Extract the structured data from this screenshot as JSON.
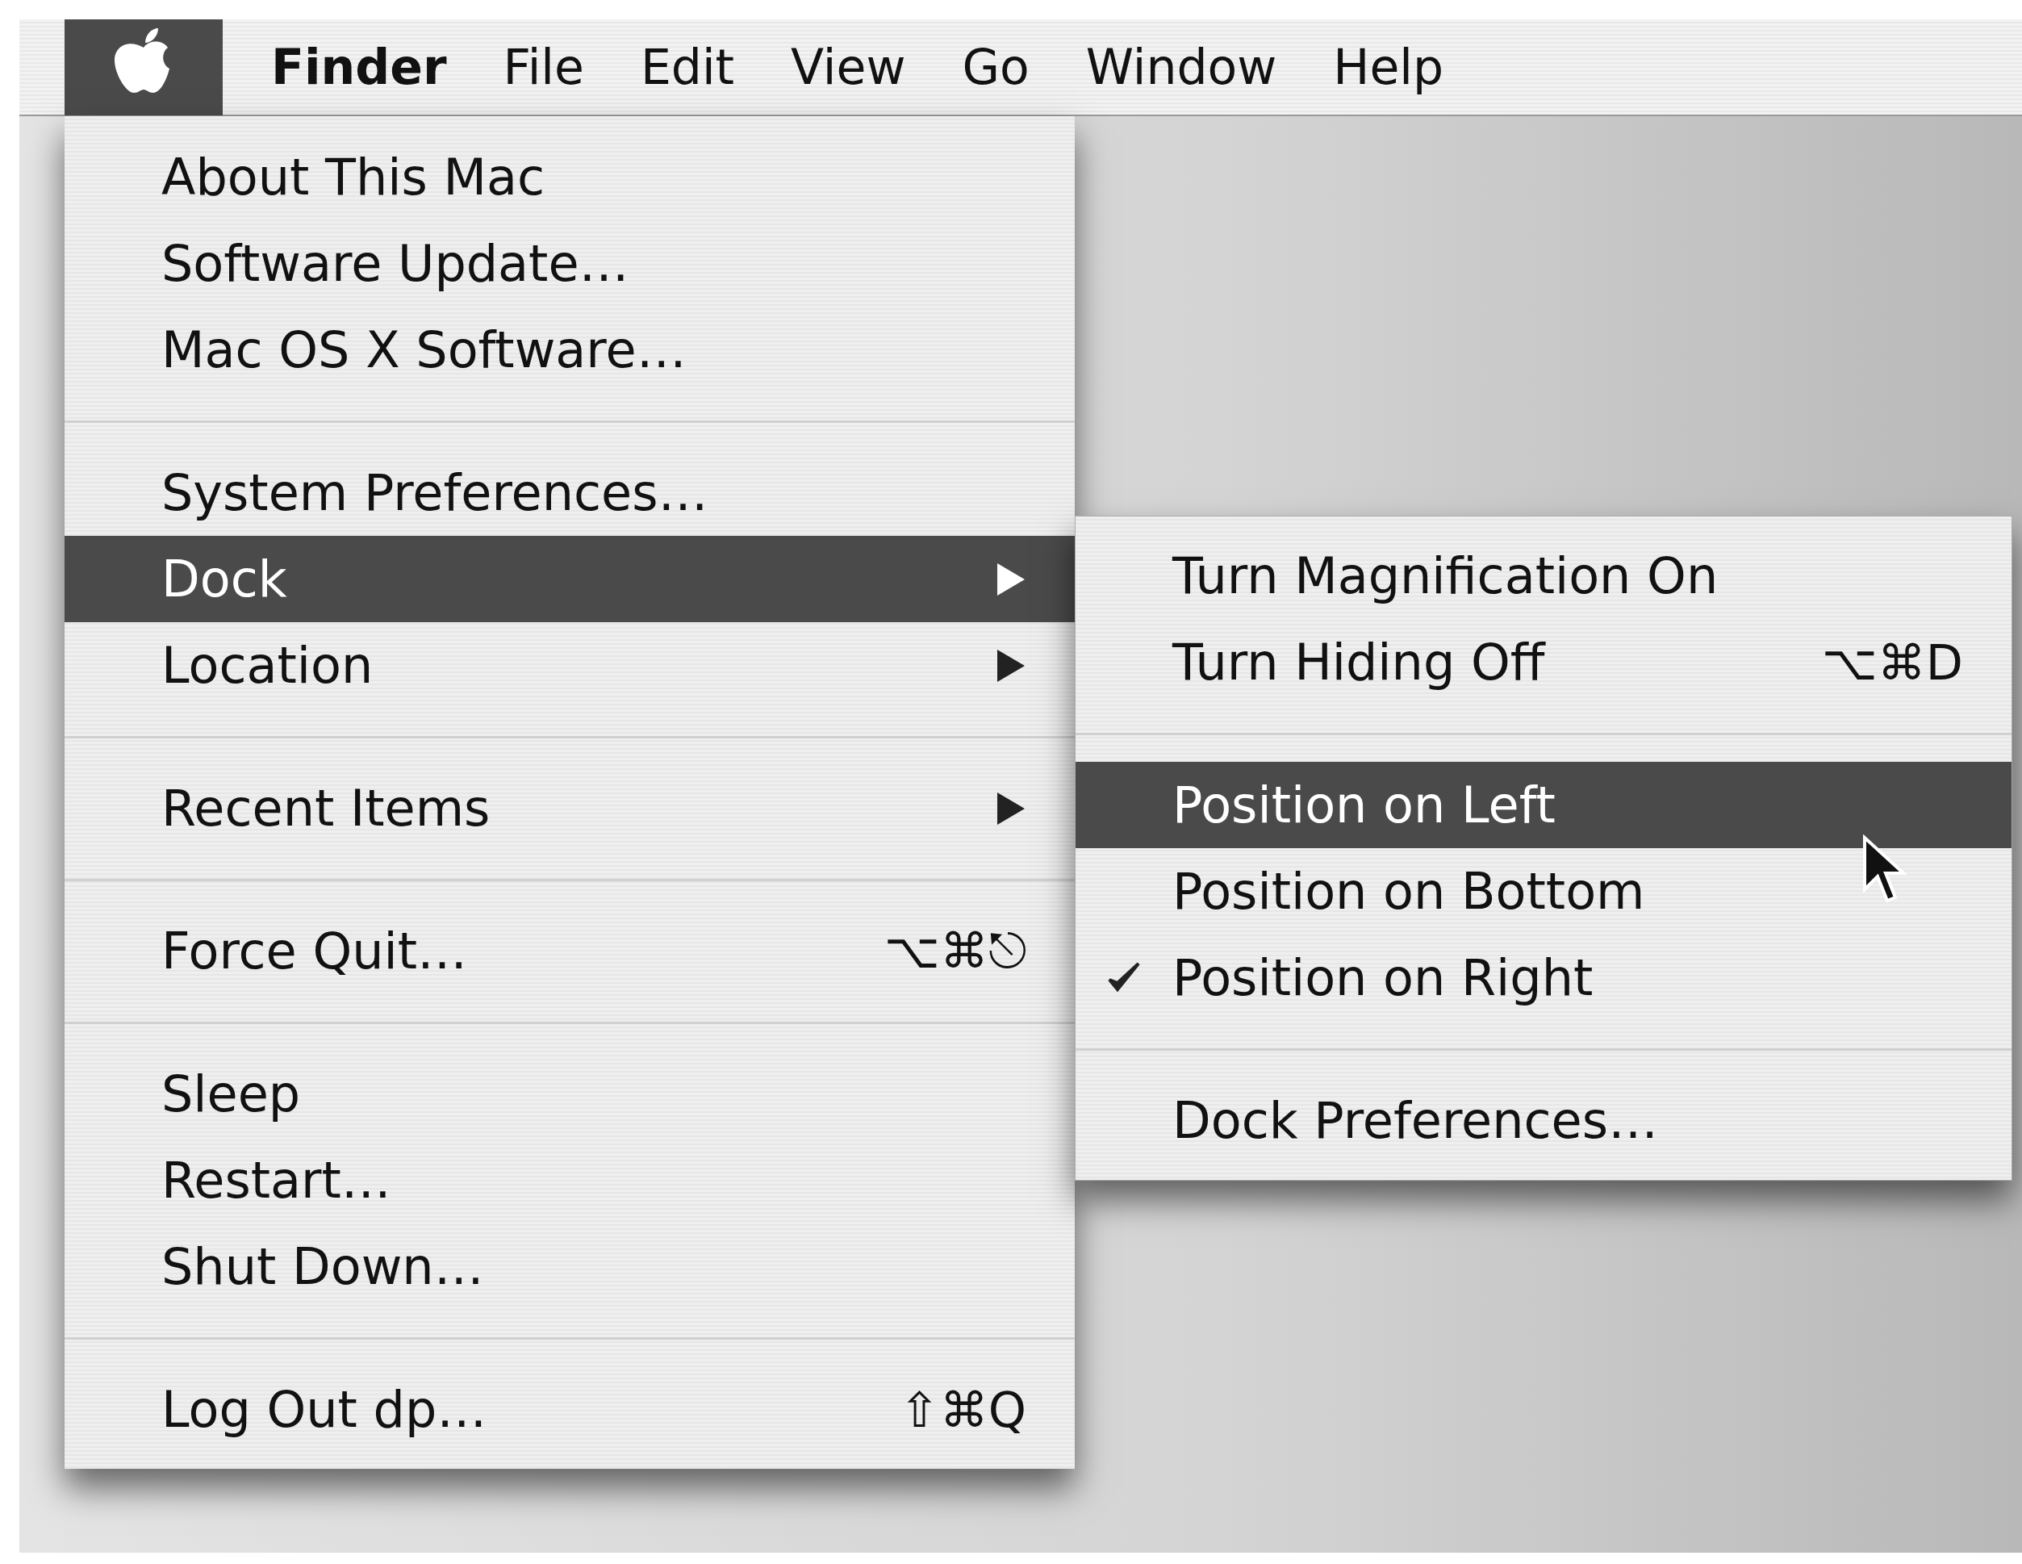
{
  "menu_bar": {
    "apple_selected": true,
    "items": [
      {
        "label": "Finder",
        "kind": "app"
      },
      {
        "label": "File",
        "kind": "menu"
      },
      {
        "label": "Edit",
        "kind": "menu"
      },
      {
        "label": "View",
        "kind": "menu"
      },
      {
        "label": "Go",
        "kind": "menu"
      },
      {
        "label": "Window",
        "kind": "menu"
      },
      {
        "label": "Help",
        "kind": "menu"
      }
    ]
  },
  "apple_menu": {
    "items": [
      {
        "kind": "item",
        "label": "About This Mac",
        "selected": false
      },
      {
        "kind": "item",
        "label": "Software Update…",
        "selected": false
      },
      {
        "kind": "item",
        "label": "Mac OS X Software…",
        "selected": false
      },
      {
        "kind": "separator"
      },
      {
        "kind": "item",
        "label": "System Preferences…",
        "selected": false
      },
      {
        "kind": "submenu",
        "label": "Dock",
        "selected": true
      },
      {
        "kind": "submenu",
        "label": "Location",
        "selected": false
      },
      {
        "kind": "separator"
      },
      {
        "kind": "submenu",
        "label": "Recent Items",
        "selected": false
      },
      {
        "kind": "separator"
      },
      {
        "kind": "item",
        "label": "Force Quit…",
        "shortcut": "⌥⌘⎋",
        "selected": false
      },
      {
        "kind": "separator"
      },
      {
        "kind": "item",
        "label": "Sleep",
        "selected": false
      },
      {
        "kind": "item",
        "label": "Restart…",
        "selected": false
      },
      {
        "kind": "item",
        "label": "Shut Down…",
        "selected": false
      },
      {
        "kind": "separator"
      },
      {
        "kind": "item",
        "label": "Log Out dp…",
        "shortcut": "⇧⌘Q",
        "selected": false
      }
    ]
  },
  "dock_submenu": {
    "items": [
      {
        "kind": "item",
        "label": "Turn Magnification On",
        "checked": false,
        "selected": false
      },
      {
        "kind": "item",
        "label": "Turn Hiding Off",
        "shortcut": "⌥⌘D",
        "checked": false,
        "selected": false
      },
      {
        "kind": "separator"
      },
      {
        "kind": "item",
        "label": "Position on Left",
        "checked": false,
        "selected": true
      },
      {
        "kind": "item",
        "label": "Position on Bottom",
        "checked": false,
        "selected": false
      },
      {
        "kind": "item",
        "label": "Position on Right",
        "checked": true,
        "selected": false
      },
      {
        "kind": "separator"
      },
      {
        "kind": "item",
        "label": "Dock Preferences…",
        "checked": false,
        "selected": false
      }
    ]
  }
}
